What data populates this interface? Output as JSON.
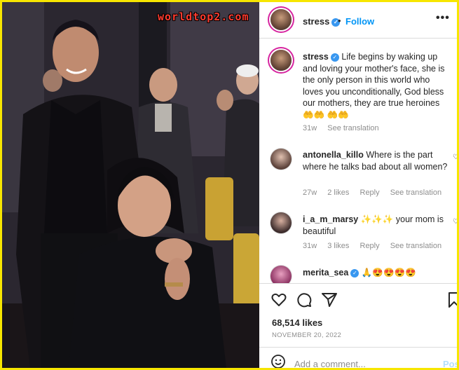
{
  "watermark": "worldtop2.com",
  "post": {
    "username": "stress",
    "follow_label": "Follow",
    "separator": "•",
    "more_label": "•••",
    "caption": "Life begins by waking up and loving your mother's face, she is the only person in this world who loves you unconditionally, God bless our mothers, they are true heroines 🤲🤲 🤲🤲",
    "caption_time": "31w",
    "see_translation": "See translation",
    "likes": "68,514 likes",
    "date": "NOVEMBER 20, 2022",
    "add_comment_placeholder": "Add a comment...",
    "post_label": "Post"
  },
  "comments": [
    {
      "username": "antonella_killo",
      "text": "Where is the part where he talks bad about all women?",
      "time": "27w",
      "likes": "2 likes",
      "reply": "Reply",
      "see_translation": "See translation"
    },
    {
      "username": "i_a_m_marsy",
      "text": "✨✨✨ your mom is beautiful",
      "time": "31w",
      "likes": "3 likes",
      "reply": "Reply",
      "see_translation": "See translation"
    },
    {
      "username": "merita_sea",
      "text": "🙏😍😍😍😍"
    }
  ],
  "icons": {
    "verified": "verified-badge-icon",
    "like": "heart-icon",
    "comment": "comment-icon",
    "share": "share-icon",
    "save": "bookmark-icon",
    "emoji": "smiley-icon"
  },
  "colors": {
    "border": "#f7e600",
    "link_blue": "#0095f6",
    "verified_blue": "#3897f0",
    "muted": "#8e8e8e",
    "watermark": "#ff3b2f"
  }
}
